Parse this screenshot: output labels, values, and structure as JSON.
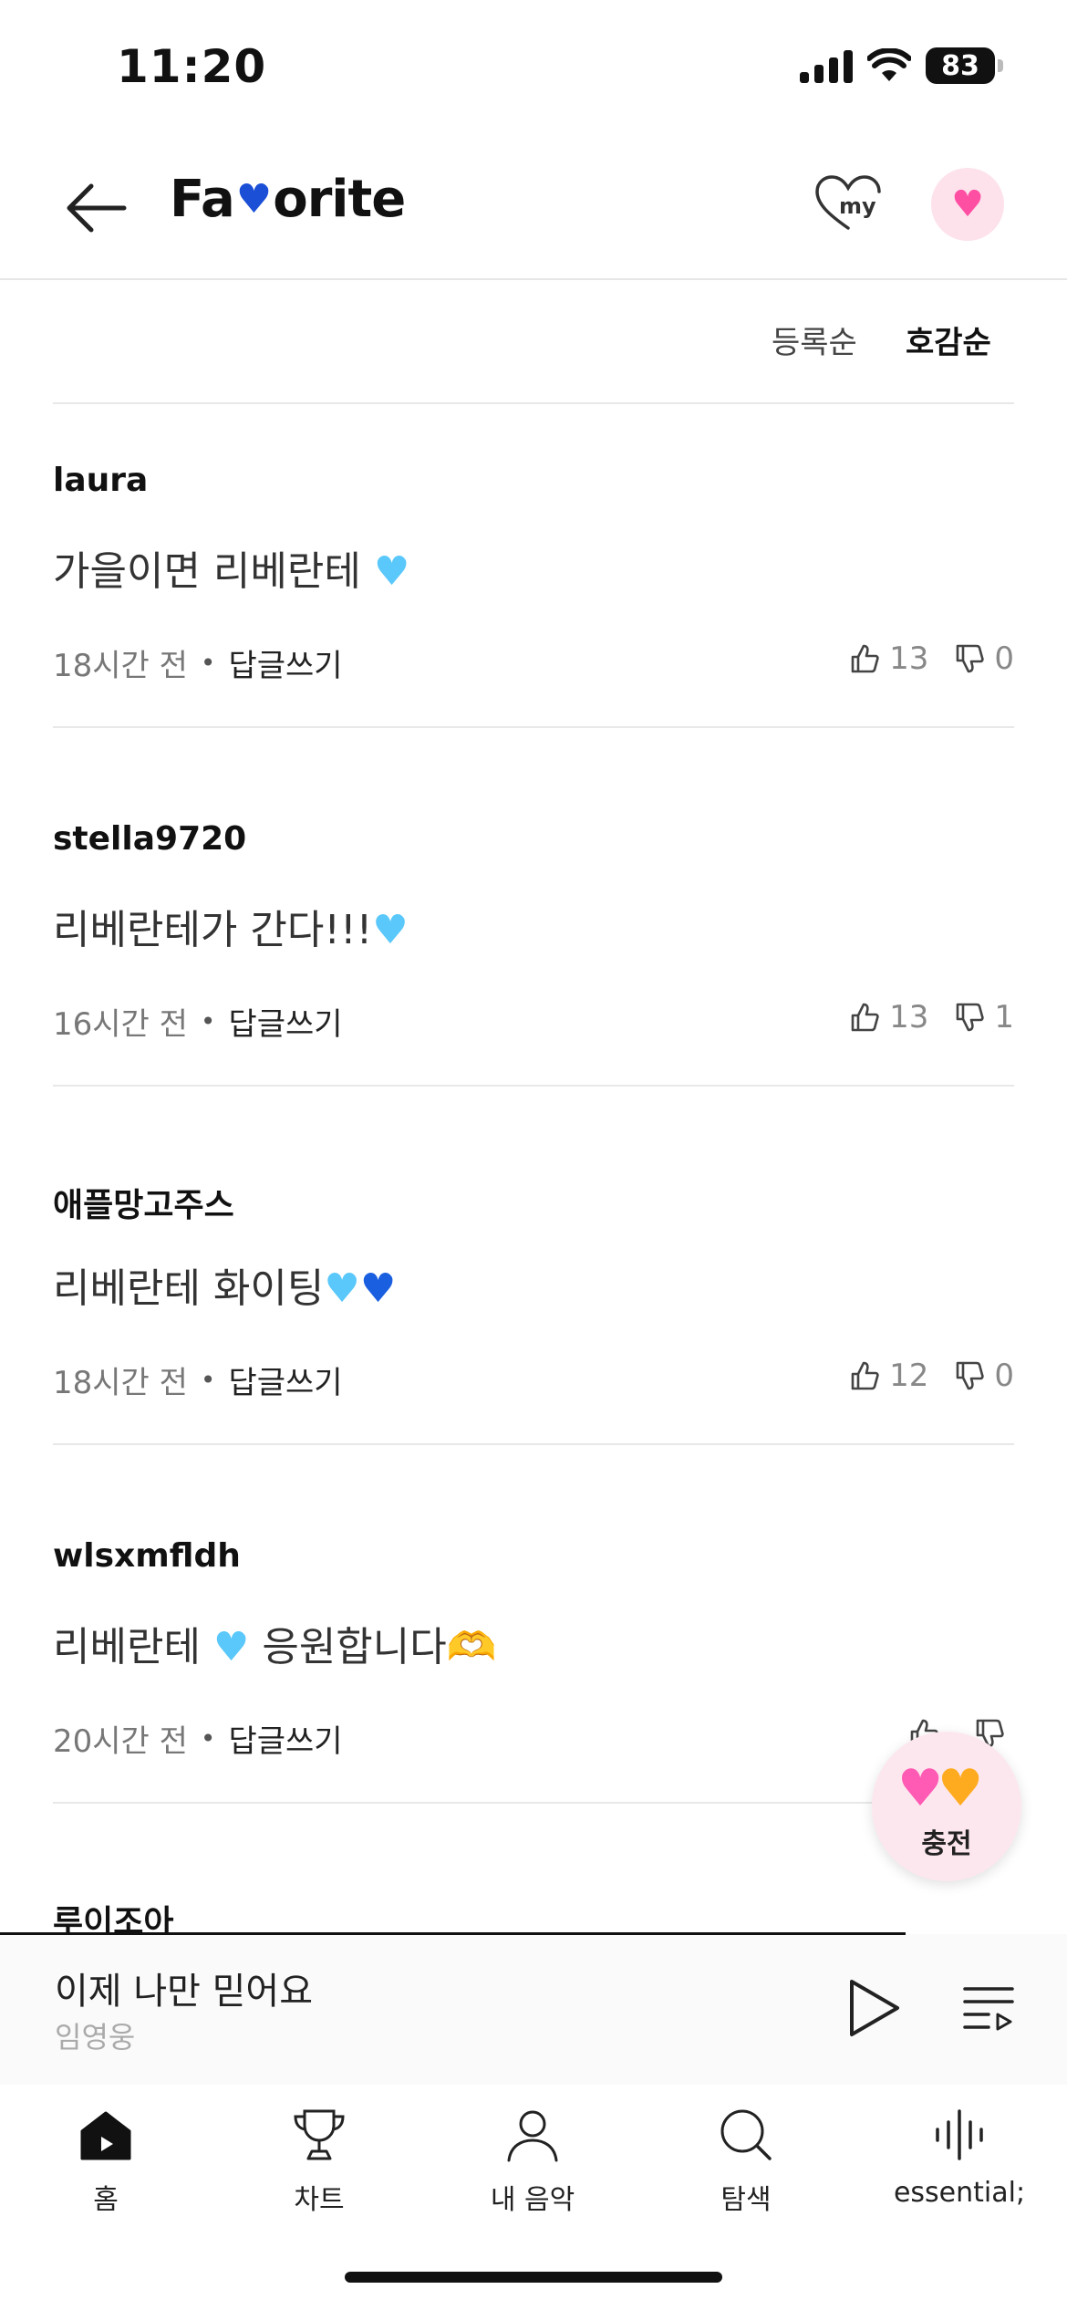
{
  "status_bar": {
    "time": "11:20",
    "battery": "83"
  },
  "header": {
    "title_start": "Fa",
    "title_heart": "♥",
    "title_end": "orite",
    "my_label": "my"
  },
  "sort": {
    "registered": "등록순",
    "likes": "호감순"
  },
  "comments": [
    {
      "user": "laura",
      "body": "가을이면 리베란테 ",
      "emoji": "♥",
      "time": "18시간 전",
      "reply": "답글쓰기",
      "likes": "13",
      "dislikes": "0"
    },
    {
      "user": "stella9720",
      "body": "리베란테가 간다!!!",
      "emoji": "♥",
      "time": "16시간 전",
      "reply": "답글쓰기",
      "likes": "13",
      "dislikes": "1"
    },
    {
      "user": "애플망고주스",
      "body": "리베란테 화이팅",
      "emoji": "♥",
      "emoji2": "♥",
      "time": "18시간 전",
      "reply": "답글쓰기",
      "likes": "12",
      "dislikes": "0"
    },
    {
      "user": "wlsxmfldh",
      "body": "리베란테 ",
      "emoji": "♥",
      "body2": " 응원합니다",
      "emoji3": "🫶",
      "time": "20시간 전",
      "reply": "답글쓰기",
      "likes": "",
      "dislikes": ""
    },
    {
      "user": "루이조아"
    }
  ],
  "fab": {
    "label": "충전"
  },
  "player": {
    "title": "이제 나만 믿어요",
    "artist": "임영웅"
  },
  "nav": [
    {
      "label": "홈"
    },
    {
      "label": "차트"
    },
    {
      "label": "내 음악"
    },
    {
      "label": "탐색"
    },
    {
      "label": "essential;"
    }
  ],
  "colors": {
    "accent_blue": "#1a4fd6",
    "light_blue_heart": "#5ac8fa",
    "fab_bg": "#fde7ee"
  }
}
